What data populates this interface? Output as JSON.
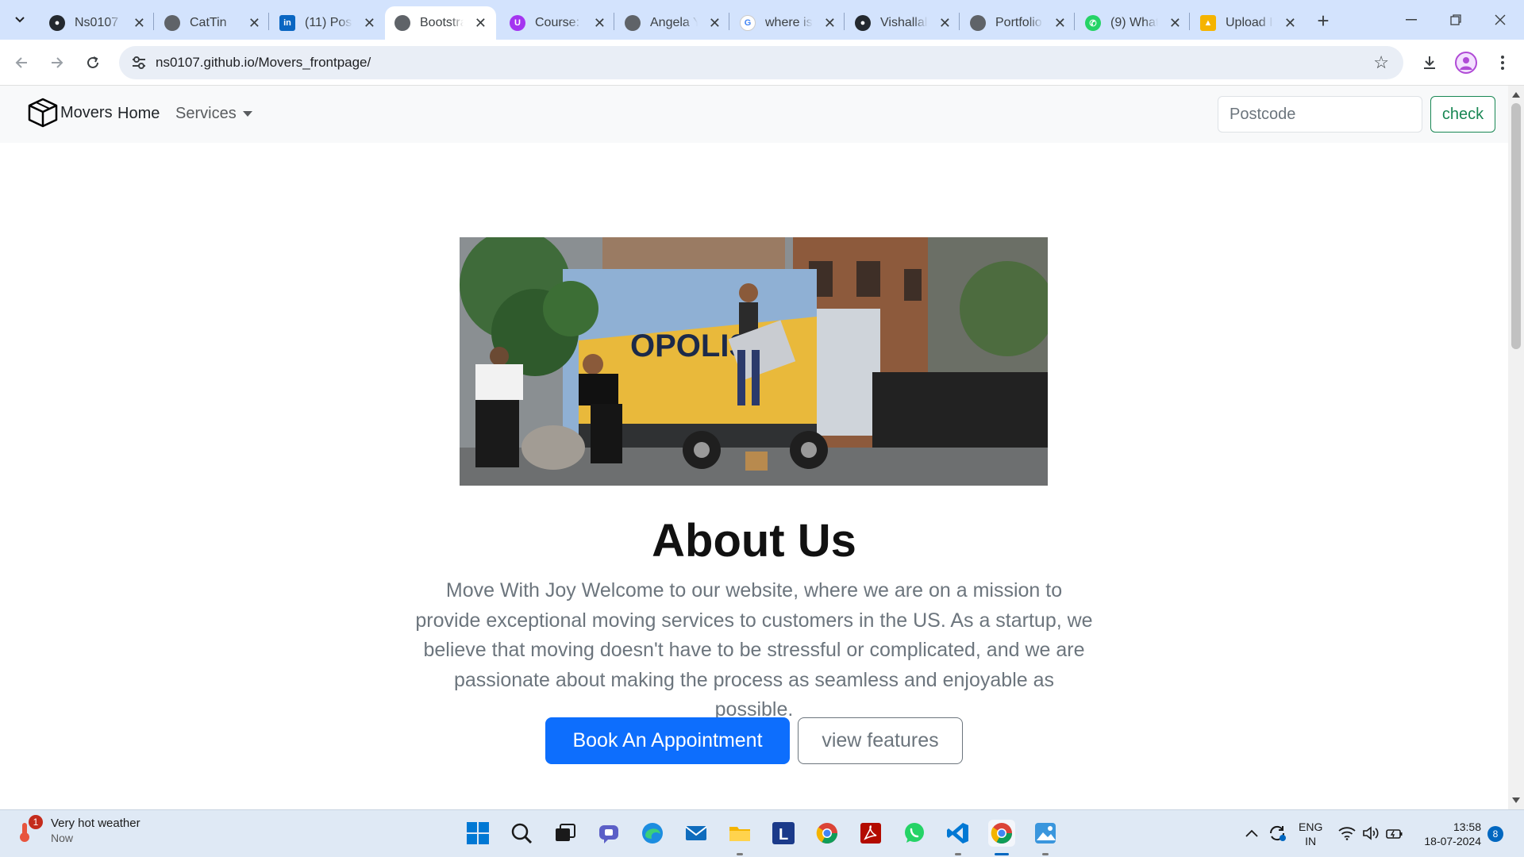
{
  "browser": {
    "tabs": [
      {
        "title": "Ns0107",
        "icon": "github-icon"
      },
      {
        "title": "CatTin",
        "icon": "globe-icon"
      },
      {
        "title": "(11) Post",
        "icon": "linkedin-icon"
      },
      {
        "title": "Bootstra",
        "icon": "globe-icon",
        "active": true
      },
      {
        "title": "Course:",
        "icon": "udemy-icon"
      },
      {
        "title": "Angela Y",
        "icon": "globe-icon"
      },
      {
        "title": "where is",
        "icon": "google-icon"
      },
      {
        "title": "Vishallal",
        "icon": "github-icon"
      },
      {
        "title": "Portfolio",
        "icon": "globe-icon"
      },
      {
        "title": "(9) What",
        "icon": "whatsapp-icon"
      },
      {
        "title": "Upload I",
        "icon": "upload-icon"
      }
    ],
    "url": "ns0107.github.io/Movers_frontpage/"
  },
  "navbar": {
    "brand": "Movers",
    "home": "Home",
    "services": "Services",
    "postcode_placeholder": "Postcode",
    "check": "check"
  },
  "hero": {
    "image_desc": "moving-truck-photo",
    "truck_text": "OPOLIS",
    "title": "About Us",
    "lead": "Move With Joy Welcome to our website, where we are on a mission to provide exceptional moving services to customers in the US. As a startup, we believe that moving doesn't have to be stressful or complicated, and we are passionate about making the process as seamless and enjoyable as possible.",
    "primary_button": "Book An Appointment",
    "secondary_button": "view features"
  },
  "taskbar": {
    "weather_title": "Very hot weather",
    "weather_sub": "Now",
    "weather_badge": "1",
    "lang_line1": "ENG",
    "lang_line2": "IN",
    "time": "13:58",
    "date": "18-07-2024",
    "notifications": "8"
  },
  "colors": {
    "primary": "#0d6efd",
    "success": "#198754",
    "navbar_bg": "#f8f9fa",
    "tabstrip_bg": "#d3e3fd"
  }
}
